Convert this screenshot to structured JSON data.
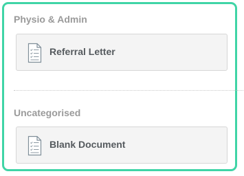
{
  "sections": [
    {
      "title": "Physio & Admin",
      "documents": [
        {
          "label": "Referral Letter",
          "icon": "document-icon"
        }
      ]
    },
    {
      "title": "Uncategorised",
      "documents": [
        {
          "label": "Blank Document",
          "icon": "document-icon"
        }
      ]
    }
  ],
  "colors": {
    "panel_border": "#3fd4a6",
    "section_title": "#9a9a9a",
    "card_background": "#f4f4f4",
    "card_border": "#d6d6d6",
    "card_text": "#555a5e",
    "icon_line": "#7f8e99"
  }
}
